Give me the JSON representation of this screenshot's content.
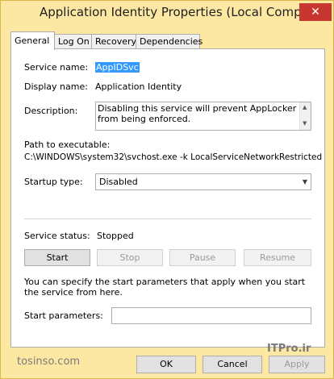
{
  "window": {
    "title": "Application Identity Properties (Local Computer)",
    "close_glyph": "✕"
  },
  "tabs": [
    {
      "label": "General"
    },
    {
      "label": "Log On"
    },
    {
      "label": "Recovery"
    },
    {
      "label": "Dependencies"
    }
  ],
  "general": {
    "service_name_label": "Service name:",
    "service_name_value": "AppIDSvc",
    "display_name_label": "Display name:",
    "display_name_value": "Application Identity",
    "description_label": "Description:",
    "description_value": "Disabling this service will prevent AppLocker from being enforced.",
    "path_label": "Path to executable:",
    "path_value": "C:\\WINDOWS\\system32\\svchost.exe -k LocalServiceNetworkRestricted",
    "startup_type_label": "Startup type:",
    "startup_type_value": "Disabled",
    "service_status_label": "Service status:",
    "service_status_value": "Stopped",
    "start_label": "Start",
    "stop_label": "Stop",
    "pause_label": "Pause",
    "resume_label": "Resume",
    "hint_text": "You can specify the start parameters that apply when you start the service from here.",
    "start_params_label": "Start parameters:",
    "start_params_value": ""
  },
  "footer": {
    "ok_label": "OK",
    "cancel_label": "Cancel",
    "apply_label": "Apply"
  },
  "watermark": {
    "left": "tosinso.com",
    "right": "ITPro.ir"
  }
}
